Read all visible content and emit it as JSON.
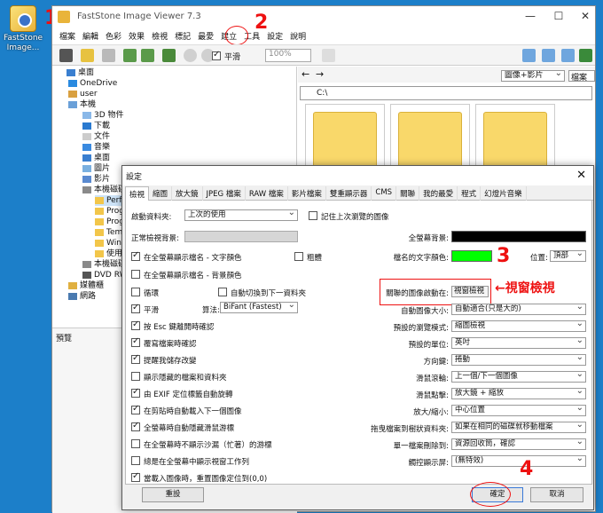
{
  "desktop": {
    "icon_label": "FastStone Image..."
  },
  "callouts": [
    "1",
    "2",
    "3",
    "4"
  ],
  "app": {
    "title": "FastStone Image Viewer 7.3"
  },
  "menu": [
    "檔案",
    "編輯",
    "色彩",
    "效果",
    "檢視",
    "標記",
    "最愛",
    "建立",
    "工具",
    "設定",
    "說明"
  ],
  "toolbar": {
    "smooth_label": "平滑",
    "zoom_value": "100%"
  },
  "tree": {
    "items": [
      "桌面",
      "OneDrive",
      "user",
      "本機",
      "3D 物件",
      "下載",
      "文件",
      "音樂",
      "桌面",
      "圖片",
      "影片",
      "本機磁碟",
      "Perf",
      "Prog",
      "Prog",
      "Tem",
      "Win",
      "使用",
      "本機磁碟",
      "DVD RW",
      "媒體櫃",
      "網路"
    ],
    "preview_label": "預覽"
  },
  "browser": {
    "sort": "圖像+影片",
    "sort2": "檔案名稱",
    "path": "C:\\"
  },
  "dialog": {
    "title": "設定",
    "tabs": [
      "檢視",
      "縮圖",
      "放大鏡",
      "JPEG 檔案",
      "RAW 檔案",
      "影片檔案",
      "雙重顯示器",
      "CMS",
      "關聯",
      "我的最愛",
      "程式",
      "幻燈片音樂"
    ],
    "left": {
      "startup_label": "啟動資料夾:",
      "startup_value": "上次的使用",
      "remember_label": "記住上次瀏覽的圖像",
      "bg_label": "正常檢視背景:",
      "cb1": "在全螢幕顯示檔名 - 文字顏色",
      "bold_label": "粗體",
      "cb2": "在全螢幕顯示檔名 - 背景顏色",
      "loop": "循環",
      "autonext": "自動切換到下一資料夾",
      "smooth": "平滑",
      "algo_label": "算法:",
      "algo_value": "BiFant (Fastest)",
      "cbs": [
        "按 Esc 鍵離開時確認",
        "覆寫檔案時確認",
        "提醒我儲存改變",
        "顯示隱藏的檔案和資料夾",
        "由 EXIF 定位標籤自動旋轉",
        "在剪貼時自動載入下一個圖像",
        "全螢幕時自動隱藏滑鼠游標",
        "在全螢幕時不顯示沙漏（忙著）的游標",
        "總是在全螢幕中顯示視窗工作列",
        "當載入圖像時，重置圖像定位到(0,0)"
      ]
    },
    "right": {
      "fs_bg_label": "全螢幕背景:",
      "fn_color_label": "檔名的文字顏色:",
      "pos_label": "位置:",
      "pos_value": "頂部",
      "open_label": "關聯的圖像啟動在:",
      "open_value": "視窗檢視",
      "rows": [
        {
          "label": "自動圖像大小:",
          "value": "自動適合(只是大的)"
        },
        {
          "label": "預設的瀏覽模式:",
          "value": "縮圖檢視"
        },
        {
          "label": "預設的單位:",
          "value": "英吋"
        },
        {
          "label": "方向鍵:",
          "value": "捲動"
        },
        {
          "label": "滑鼠滾輪:",
          "value": "上一個/下一個圖像"
        },
        {
          "label": "滑鼠點擊:",
          "value": "放大鏡 + 縮放"
        },
        {
          "label": "放大/縮小:",
          "value": "中心位置"
        },
        {
          "label": "拖曳檔案到樹狀資料夾:",
          "value": "如果在相同的磁碟就移動檔案"
        },
        {
          "label": "單一檔案刪除到:",
          "value": "資源回收筒，確認"
        },
        {
          "label": "觸控顯示屏:",
          "value": "(無特效)"
        }
      ]
    },
    "reset_label": "重設",
    "ok_label": "確定",
    "cancel_label": "取消"
  },
  "annotation": {
    "arrow_text": "←視窗檢視"
  },
  "colors": {
    "fullscreen_bg": "#000000",
    "filename_color": "#00ff00",
    "annotation": "#e11111"
  }
}
